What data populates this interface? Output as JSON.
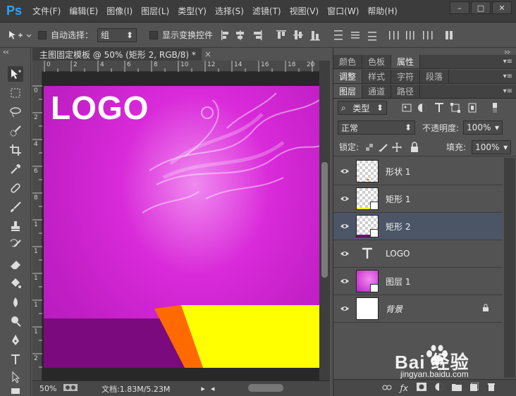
{
  "app": {
    "logo": "Ps",
    "menu": [
      "文件(F)",
      "编辑(E)",
      "图像(I)",
      "图层(L)",
      "类型(Y)",
      "选择(S)",
      "滤镜(T)",
      "视图(V)",
      "窗口(W)",
      "帮助(H)"
    ],
    "window_buttons": [
      "–",
      "□",
      "✕"
    ]
  },
  "options_bar": {
    "auto_select_label": "自动选择：",
    "auto_select_value": "组",
    "show_transform_label": "显示变换控件"
  },
  "document": {
    "tab_title": "主图固定模板 @ 50% (矩形 2, RGB/8) *",
    "tab_close": "×",
    "ruler_h_labels": [
      "0",
      "2",
      "4",
      "6",
      "8",
      "10",
      "12",
      "14",
      "16",
      "18",
      "20"
    ],
    "ruler_v_labels": [
      "0",
      "2",
      "4",
      "6",
      "8",
      "1",
      "1",
      "1",
      "1",
      "1",
      "2"
    ],
    "canvas": {
      "logo_text": "LOGO",
      "bg_color": "#c91fcb",
      "bar_purple": "#7a0a7e",
      "triangle_orange": "#ff6a00",
      "band_yellow": "#ffff00"
    }
  },
  "statusbar": {
    "zoom": "50%",
    "doc_info": "文档:1.83M/5.23M"
  },
  "panels": {
    "row1_tabs": [
      "颜色",
      "色板",
      "属性"
    ],
    "row1_active": "属性",
    "row2_tabs": [
      "调整",
      "样式",
      "字符",
      "段落"
    ],
    "row2_active": "调整",
    "row3_tabs": [
      "图层",
      "通道",
      "路径"
    ],
    "row3_active": "图层",
    "filter_kind": "类型",
    "blend_mode": "正常",
    "opacity_label": "不透明度:",
    "opacity_value": "100%",
    "lock_label": "锁定:",
    "fill_label": "填充:",
    "fill_value": "100%"
  },
  "layers": [
    {
      "name": "形状 1",
      "thumb": "shape",
      "selected": false
    },
    {
      "name": "矩形 1",
      "thumb": "rect",
      "selected": false
    },
    {
      "name": "矩形 2",
      "thumb": "rect2",
      "selected": true
    },
    {
      "name": "LOGO",
      "thumb": "text",
      "selected": false
    },
    {
      "name": "图层 1",
      "thumb": "image",
      "selected": false
    },
    {
      "name": "背景",
      "thumb": "white",
      "selected": false,
      "locked": true
    }
  ],
  "watermark": {
    "main": "Bai 经验",
    "sub": "jingyan.baidu.com"
  }
}
